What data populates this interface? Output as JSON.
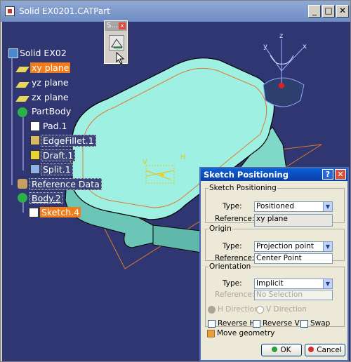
{
  "window": {
    "title": "Solid EX0201.CATPart",
    "min": "_",
    "max": "□",
    "close": "✕"
  },
  "toolbar_mini": {
    "title": "S...",
    "close": "x"
  },
  "tree": {
    "root": "Solid EX02",
    "items": [
      {
        "label": "xy plane",
        "highlight": true
      },
      {
        "label": "yz plane"
      },
      {
        "label": "zx plane"
      },
      {
        "label": "PartBody"
      },
      {
        "label": "Pad.1"
      },
      {
        "label": "EdgeFillet.1"
      },
      {
        "label": "Draft.1"
      },
      {
        "label": "Split.1"
      },
      {
        "label": "Reference Data"
      },
      {
        "label": "Body.2"
      },
      {
        "label": "Sketch.4",
        "highlight": true
      }
    ]
  },
  "axis": {
    "h": "H",
    "v": "V",
    "x": "x",
    "y": "y",
    "z": "z"
  },
  "dialog": {
    "title": "Sketch Positioning",
    "help": "?",
    "close": "✕",
    "sketch_positioning": {
      "legend": "Sketch Positioning",
      "type_label": "Type:",
      "type_value": "Positioned",
      "ref_label": "Reference:",
      "ref_value": "xy plane"
    },
    "origin": {
      "legend": "Origin",
      "type_label": "Type:",
      "type_value": "Projection point",
      "ref_label": "Reference:",
      "ref_value": "Center Point"
    },
    "orientation": {
      "legend": "Orientation",
      "type_label": "Type:",
      "type_value": "Implicit",
      "ref_label": "Reference:",
      "ref_value": "No Selection",
      "h_direction": "H Direction",
      "v_direction": "V Direction",
      "reverse_h": "Reverse H",
      "reverse_v": "Reverse V",
      "swap": "Swap"
    },
    "move_geometry": "Move geometry",
    "ok": "OK",
    "cancel": "Cancel"
  },
  "colors": {
    "viewport": "#2f3672",
    "part": "#8ee7d8",
    "highlight": "#f07d1a"
  }
}
